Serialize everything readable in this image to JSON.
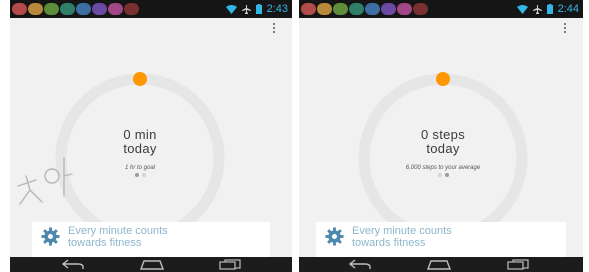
{
  "colors": {
    "accent_orange": "#ff9800",
    "ring_track": "#e6e6e6",
    "status_clock": "#33b5e5",
    "card_text": "#8cb6cd"
  },
  "screens": [
    {
      "status": {
        "time": "2:43"
      },
      "goal_value": "0 min",
      "goal_period": "today",
      "goal_caption": "1 hr to goal",
      "page_indicator": {
        "count": 2,
        "active": 0
      },
      "card": {
        "line1": "Every minute counts",
        "line2": "towards fitness",
        "icon": "gear-icon"
      }
    },
    {
      "status": {
        "time": "2:44"
      },
      "goal_value": "0 steps",
      "goal_period": "today",
      "goal_caption": "6,000 steps to your average",
      "page_indicator": {
        "count": 2,
        "active": 1
      },
      "card": {
        "line1": "Every minute counts",
        "line2": "towards fitness",
        "icon": "gear-icon"
      }
    }
  ],
  "navbar": {
    "icons": [
      "back-icon",
      "home-icon",
      "recent-apps-icon"
    ]
  }
}
